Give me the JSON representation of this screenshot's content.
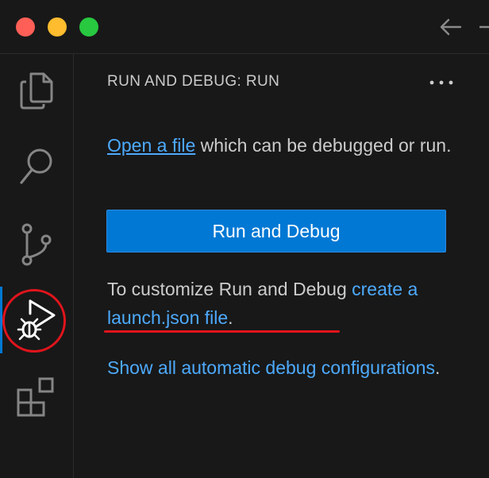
{
  "sidebar": {
    "title": "RUN AND DEBUG: RUN",
    "more_actions_icon": "ellipsis-icon",
    "open_file_link": "Open a file",
    "open_file_rest": " which can be debugged or run.",
    "run_debug_button": "Run and Debug",
    "customize_text": "To customize Run and Debug ",
    "launch_json_link": "create a launch.json file",
    "launch_json_suffix": ".",
    "show_all_link": "Show all automatic debug configurations",
    "show_all_suffix": "."
  },
  "activitybar": {
    "items": [
      {
        "icon": "explorer-icon"
      },
      {
        "icon": "search-icon"
      },
      {
        "icon": "source-control-icon"
      },
      {
        "icon": "run-debug-icon",
        "active": true
      },
      {
        "icon": "extensions-icon"
      }
    ]
  },
  "titlebar": {
    "buttons": [
      "close",
      "minimize",
      "maximize"
    ],
    "nav": [
      "back-arrow-icon",
      "forward-arrow-icon"
    ]
  },
  "colors": {
    "background": "#181818",
    "text": "#cccccc",
    "link": "#4daafc",
    "accent": "#0078d4",
    "annotation": "#e0141c"
  }
}
